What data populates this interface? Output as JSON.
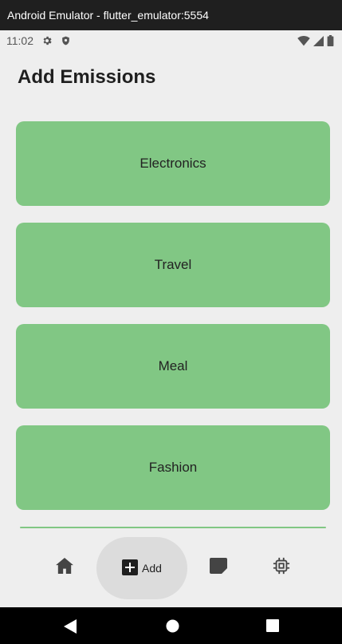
{
  "window": {
    "title": "Android Emulator - flutter_emulator:5554"
  },
  "status_bar": {
    "time": "11:02",
    "left_icons": [
      "gear-icon",
      "shield-icon"
    ],
    "right_icons": [
      "wifi-icon",
      "signal-icon",
      "battery-icon"
    ]
  },
  "page": {
    "title": "Add Emissions"
  },
  "categories": [
    {
      "label": "Electronics"
    },
    {
      "label": "Travel"
    },
    {
      "label": "Meal"
    },
    {
      "label": "Fashion"
    }
  ],
  "bottom_nav": {
    "items": [
      {
        "icon": "home-icon",
        "label": ""
      },
      {
        "icon": "add-box-icon",
        "label": "Add",
        "selected": true
      },
      {
        "icon": "note-icon",
        "label": ""
      },
      {
        "icon": "chip-icon",
        "label": ""
      }
    ]
  },
  "colors": {
    "card": "#81c784",
    "background": "#eeeeee",
    "nav_selected": "#dcdcdc",
    "titlebar": "#1f1f1f"
  }
}
